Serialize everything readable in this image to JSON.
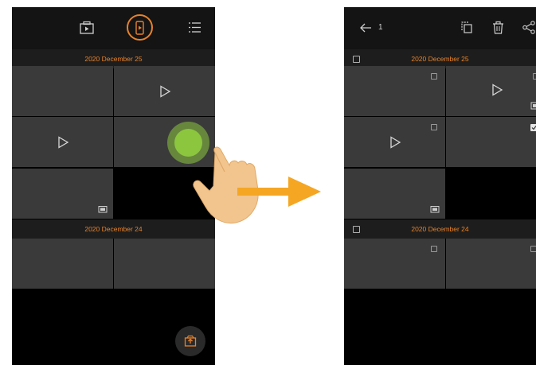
{
  "left": {
    "sections": [
      {
        "title": "2020 December 25"
      },
      {
        "title": "2020 December 24"
      }
    ]
  },
  "right": {
    "selected_count": "1",
    "sections": [
      {
        "title": "2020 December 25"
      },
      {
        "title": "2020 December 24"
      }
    ]
  },
  "colors": {
    "accent": "#e8822a",
    "tile": "#3a3a3a",
    "topbar": "#141414",
    "tap_indicator": "#8cc63f",
    "arrow": "#f5a623"
  },
  "icons": [
    "camera-icon",
    "phone-gallery-icon",
    "list-icon",
    "back-arrow-icon",
    "copy-icon",
    "trash-icon",
    "share-icon",
    "play-icon",
    "photo-badge-icon",
    "upload-icon",
    "hand-pointer-icon"
  ]
}
